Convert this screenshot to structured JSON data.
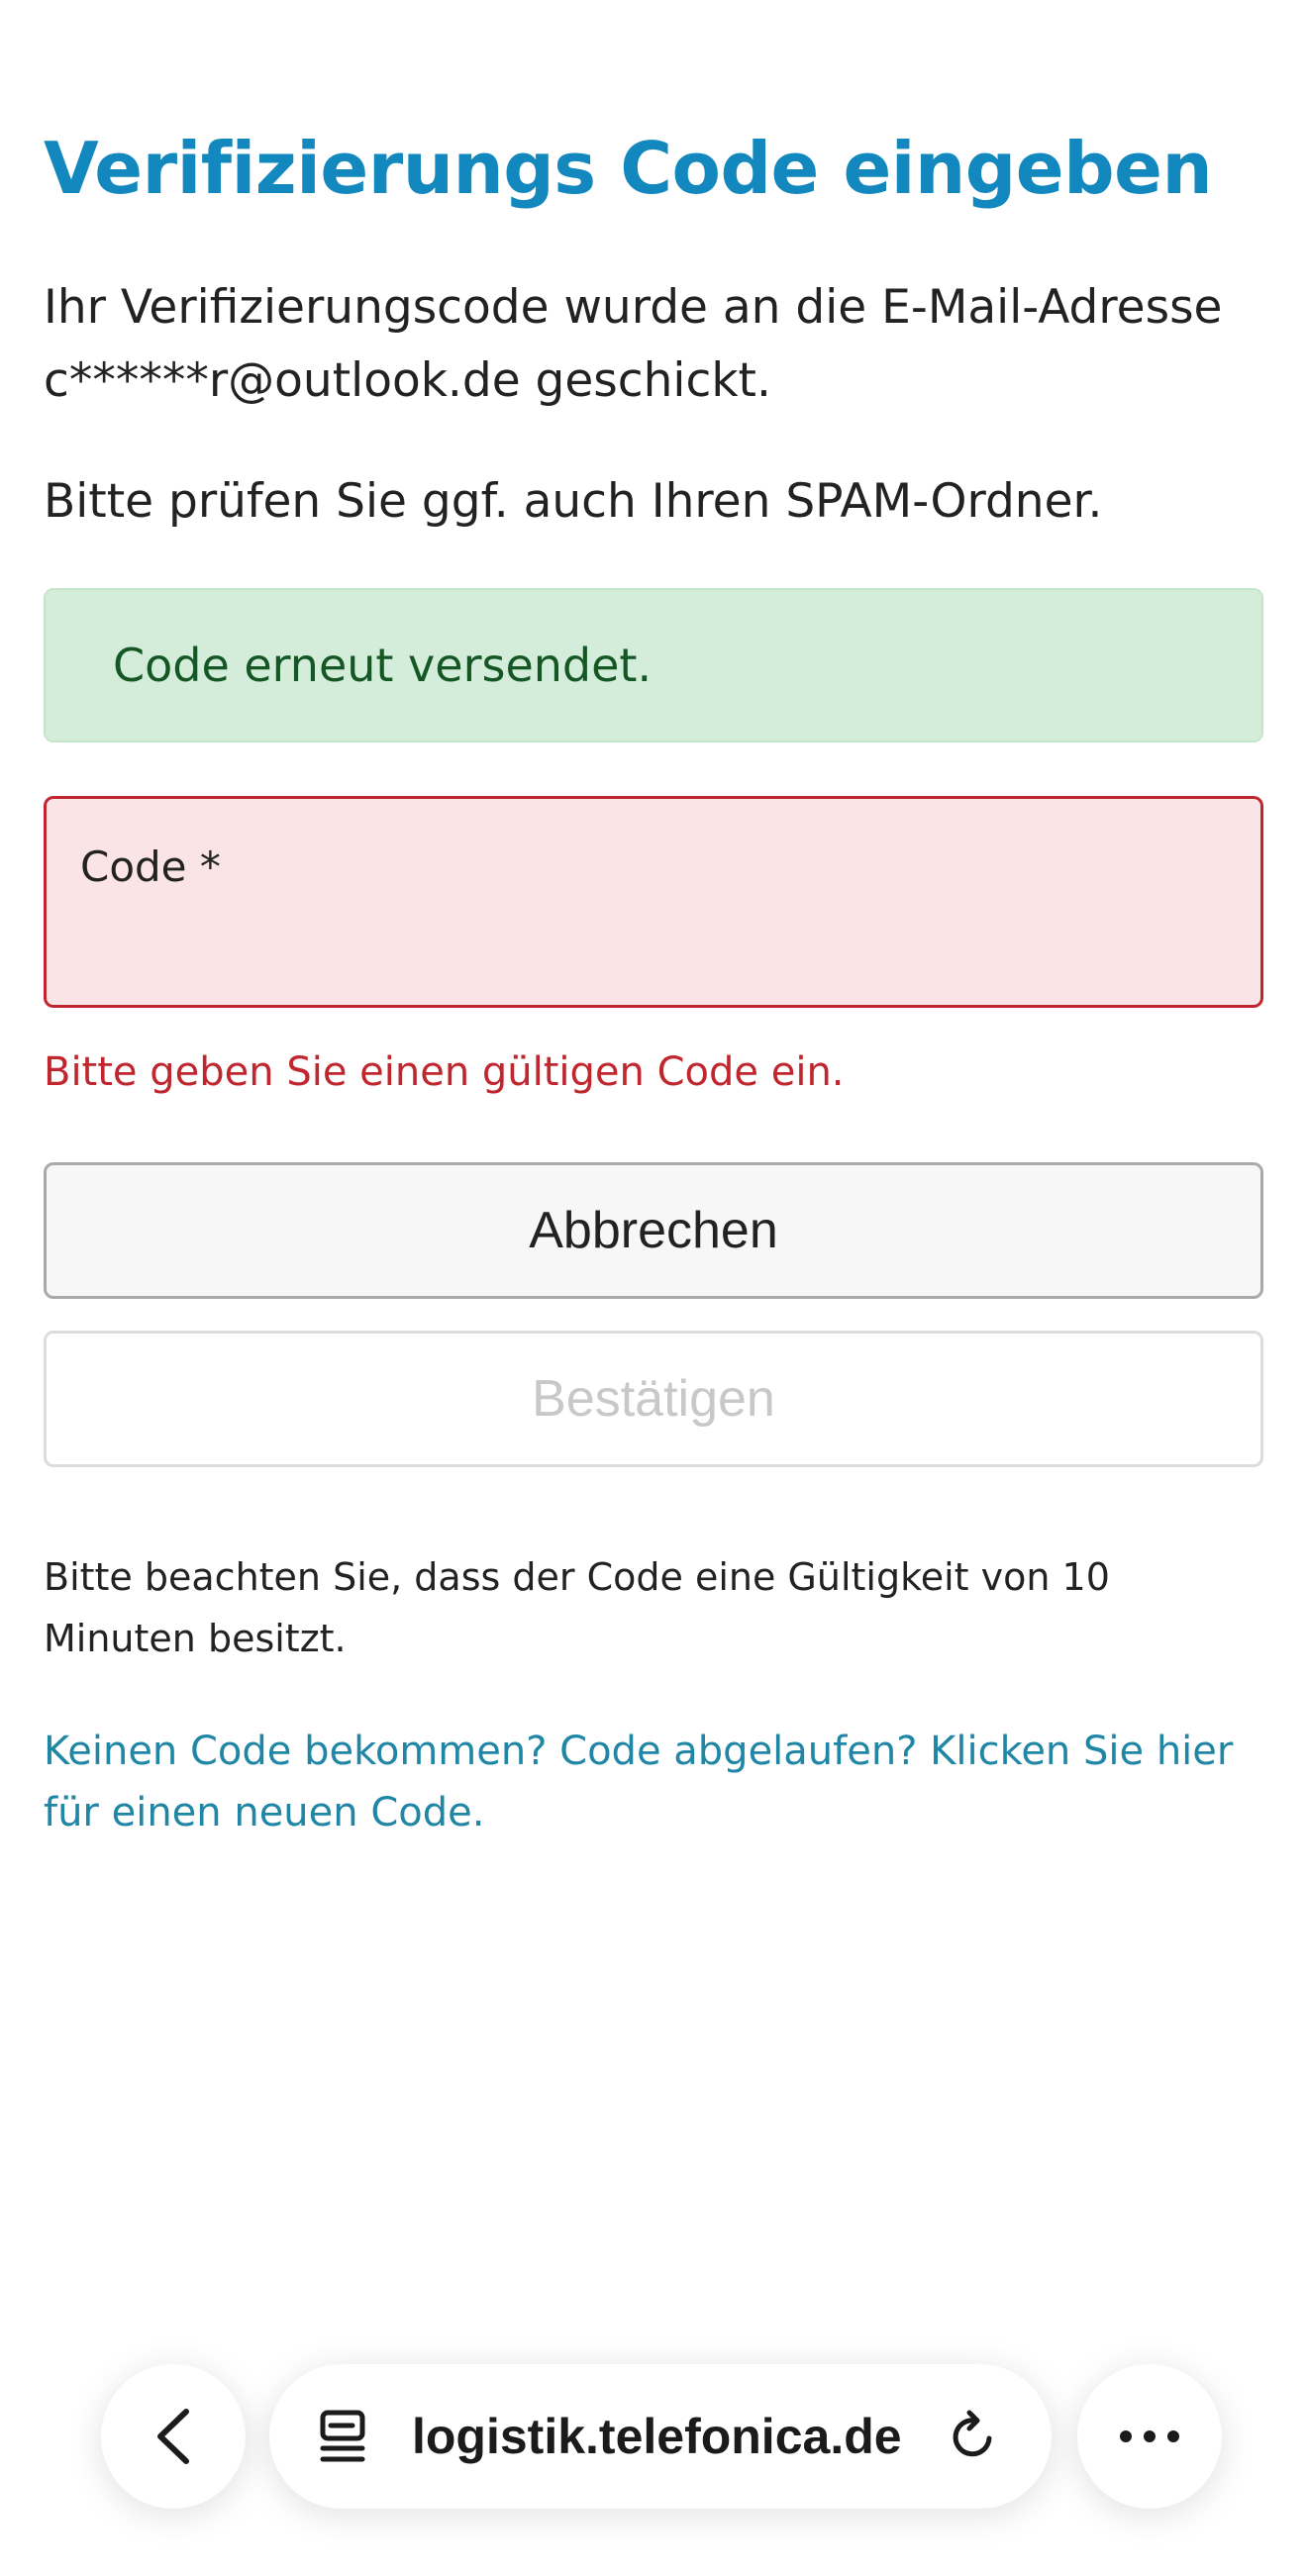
{
  "page": {
    "title": "Verifizierungs Code eingeben",
    "intro_line1": "Ihr Verifizierungscode wurde an die E-Mail-Adresse",
    "intro_line2": "c******r@outlook.de geschickt.",
    "spam_hint": "Bitte prüfen Sie ggf. auch Ihren SPAM-Ordner."
  },
  "alert": {
    "message": "Code erneut versendet."
  },
  "code_field": {
    "label": "Code *",
    "value": "",
    "error": "Bitte geben Sie einen gültigen Code ein."
  },
  "buttons": {
    "cancel_label": "Abbrechen",
    "confirm_label": "Bestätigen"
  },
  "footer": {
    "validity_note": "Bitte beachten Sie, dass der Code eine Gültigkeit von 10 Minuten besitzt.",
    "resend_link": "Keinen Code bekommen? Code abgelaufen? Klicken Sie hier für einen neuen Code."
  },
  "browser": {
    "url": "logistik.telefonica.de",
    "icons": [
      "back-chevron-icon",
      "tabs-icon",
      "reload-icon",
      "more-icon"
    ]
  },
  "colors": {
    "title": "#1288be",
    "success_bg": "#d4edda",
    "success_text": "#155724",
    "error": "#c0262d",
    "error_bg": "#fbe4e6",
    "link": "#1f86a6"
  }
}
